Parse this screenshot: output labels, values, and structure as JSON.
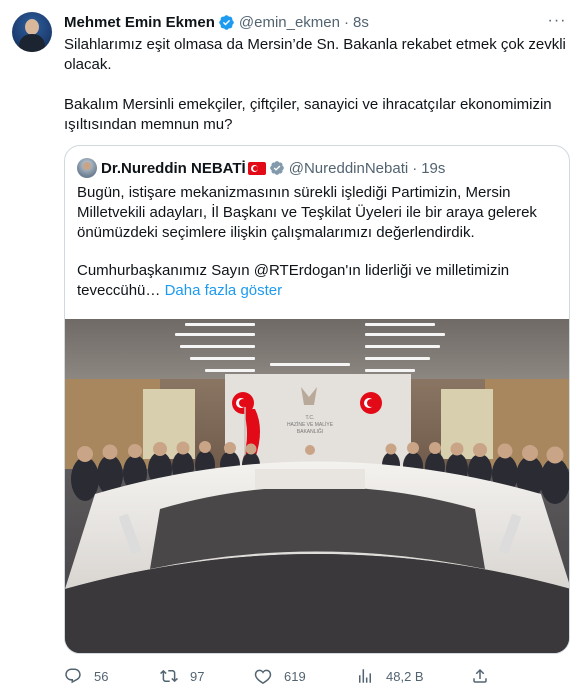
{
  "author": {
    "name": "Mehmet Emin Ekmen",
    "handle": "@emin_ekmen",
    "separator": "·",
    "time": "8s",
    "verified_color": "#1d9bf0"
  },
  "more_label": "···",
  "tweet": {
    "paragraph1": "Silahlarımız eşit olmasa da Mersin’de Sn. Bakanla rekabet etmek çok zevkli olacak.",
    "paragraph2": "Bakalım Mersinli emekçiler, çiftçiler, sanayici ve ihracatçılar ekonomimizin ışıltısından memnun mu?"
  },
  "quoted": {
    "name": "Dr.Nureddin NEBATİ",
    "handle": "@NureddinNebati",
    "separator": "·",
    "time": "19s",
    "paragraph1": "Bugün, istişare mekanizmasının sürekli işlediği Partimizin, Mersin Milletvekili adayları, İl Başkanı ve Teşkilat Üyeleri ile bir araya gelerek önümüzdeki seçimlere ilişkin çalışmalarımızı değerlendirdik.",
    "paragraph2": "Cumhurbaşkanımız Sayın @RTErdogan'ın liderliği ve milletimizin teveccühü…",
    "show_more": "Daha fazla göster",
    "image_sign": [
      "T.C.",
      "HAZİNE VE MALİYE",
      "BAKANLIĞI"
    ]
  },
  "actions": {
    "replies": "56",
    "retweets": "97",
    "likes": "619",
    "views": "48,2 B"
  },
  "colors": {
    "text": "#0f1419",
    "secondary": "#536471",
    "link": "#1d9bf0",
    "border": "#cfd9de"
  }
}
